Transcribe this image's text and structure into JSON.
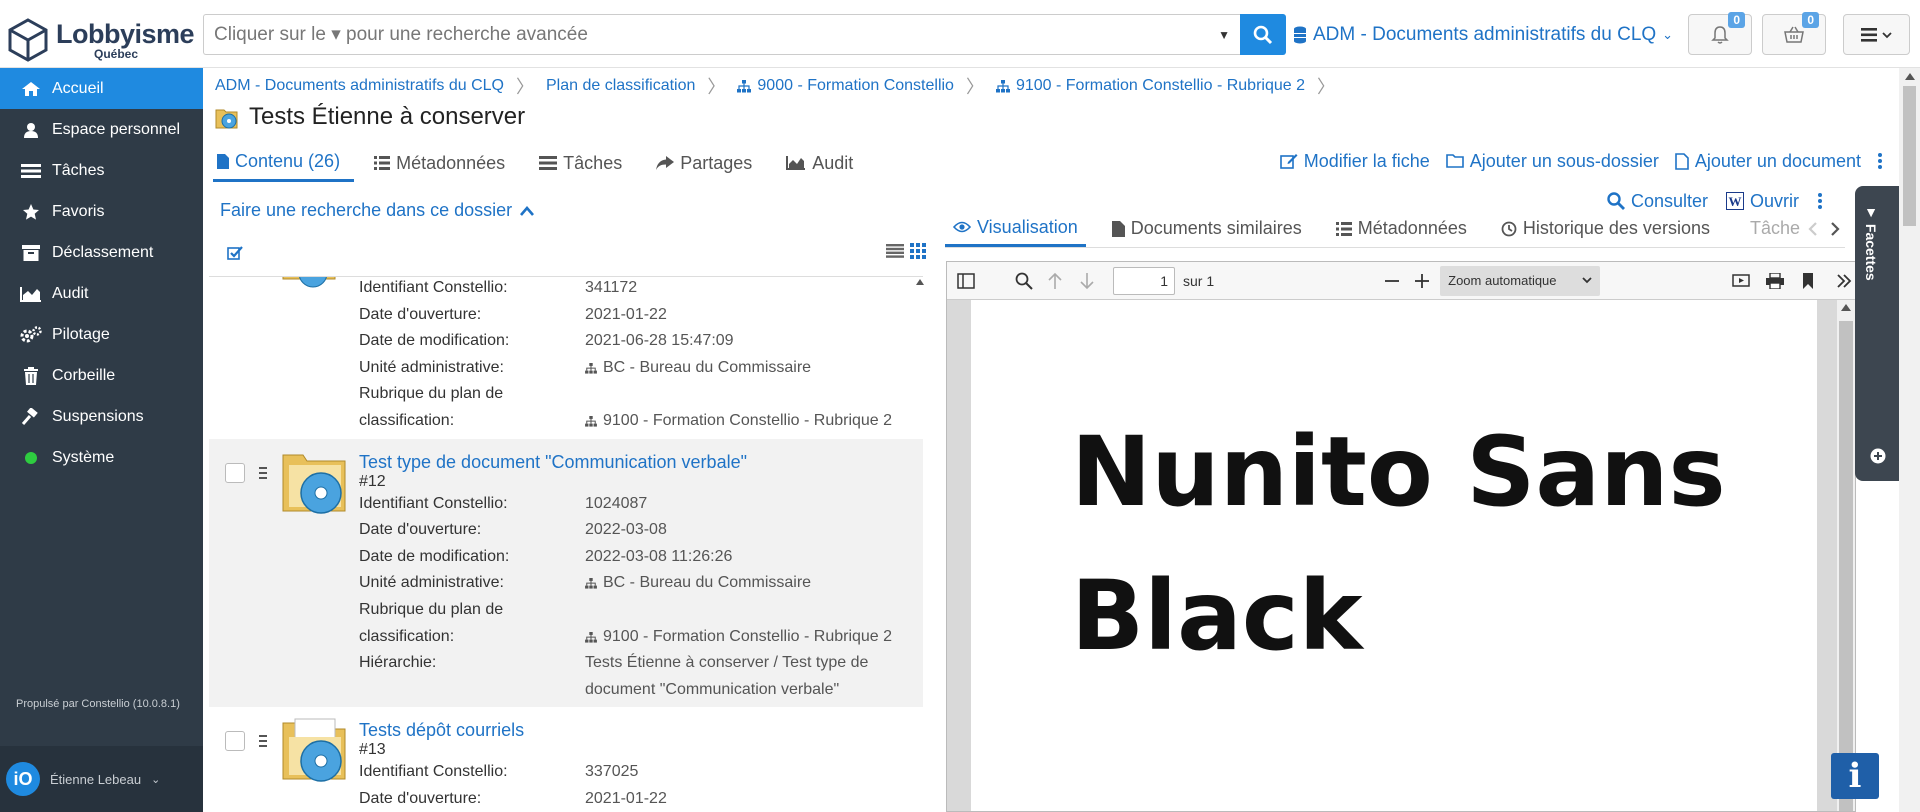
{
  "brand": {
    "name": "Lobbyisme",
    "sub": "Québec"
  },
  "search": {
    "placeholder": "Cliquer sur le ▾ pour une recherche avancée"
  },
  "collection": {
    "label": "ADM - Documents administratifs du CLQ"
  },
  "notifications": {
    "count": "0"
  },
  "cart": {
    "count": "0"
  },
  "sidebar": {
    "items": [
      {
        "label": "Accueil",
        "icon": "home-icon"
      },
      {
        "label": "Espace personnel",
        "icon": "user-icon"
      },
      {
        "label": "Tâches",
        "icon": "tasks-icon"
      },
      {
        "label": "Favoris",
        "icon": "star-icon"
      },
      {
        "label": "Déclassement",
        "icon": "archive-icon"
      },
      {
        "label": "Audit",
        "icon": "area-chart-icon"
      },
      {
        "label": "Pilotage",
        "icon": "cogs-icon"
      },
      {
        "label": "Corbeille",
        "icon": "trash-icon"
      },
      {
        "label": "Suspensions",
        "icon": "gavel-icon"
      },
      {
        "label": "Système",
        "icon": "status-dot-icon"
      }
    ],
    "powered": "Propulsé par Constellio (10.0.8.1)",
    "user": {
      "name": "Étienne Lebeau",
      "avatar": "iO"
    }
  },
  "breadcrumb": [
    "ADM - Documents administratifs du CLQ",
    "Plan de classification",
    "9000 - Formation Constellio",
    "9100 - Formation Constellio - Rubrique 2"
  ],
  "page": {
    "title": "Tests Étienne à conserver"
  },
  "tabs": [
    "Contenu (26)",
    "Métadonnées",
    "Tâches",
    "Partages",
    "Audit"
  ],
  "actions": [
    "Modifier la fiche",
    "Ajouter un sous-dossier",
    "Ajouter un document"
  ],
  "folder_search": "Faire une recherche dans ce dossier",
  "labels": {
    "id": "Identifiant Constellio:",
    "open": "Date d'ouverture:",
    "mod": "Date de modification:",
    "unit": "Unité administrative:",
    "rub1": "Rubrique du plan de",
    "rub2": "classification:",
    "hier": "Hiérarchie:"
  },
  "records": [
    {
      "id": "341172",
      "open": "2021-01-22",
      "mod": "2021-06-28 15:47:09",
      "unit": "BC - Bureau du Commissaire",
      "rub": "9100 - Formation Constellio - Rubrique 2"
    },
    {
      "title": "Test type de document \"Communication verbale\"",
      "num": "#12",
      "id": "1024087",
      "open": "2022-03-08",
      "mod": "2022-03-08 11:26:26",
      "unit": "BC - Bureau du Commissaire",
      "rub": "9100 - Formation Constellio - Rubrique 2",
      "hier": "Tests Étienne à conserver / Test type de document \"Communication verbale\""
    },
    {
      "title": "Tests dépôt courriels",
      "num": "#13",
      "id": "337025",
      "open": "2021-01-22"
    }
  ],
  "viewer": {
    "actions": [
      "Consulter",
      "Ouvrir"
    ],
    "tabs": [
      "Visualisation",
      "Documents similaires",
      "Métadonnées",
      "Historique des versions",
      "Tâche"
    ],
    "page_input": "1",
    "page_of": "sur 1",
    "zoom": "Zoom automatique",
    "content_line1": "Nunito Sans",
    "content_line2": "Black"
  },
  "facettes": "Facettes",
  "colors": {
    "accent": "#1f8ae0",
    "link": "#1f73c6",
    "sidebar": "#2f3b47"
  }
}
